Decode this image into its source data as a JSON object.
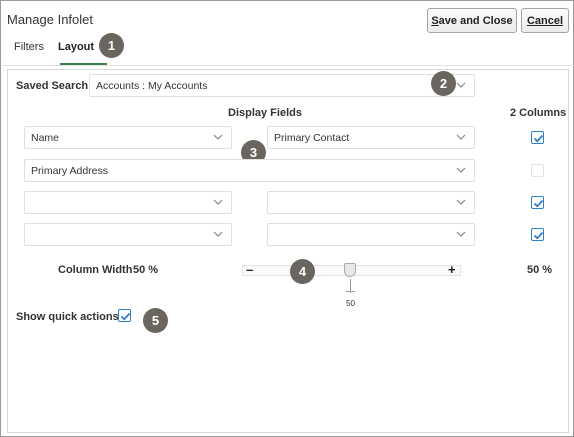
{
  "dialog": {
    "title": "Manage Infolet",
    "save_close_first": "S",
    "save_close_rest": "ave and Close",
    "cancel_first": "C",
    "cancel_rest": "ancel"
  },
  "tabs": [
    {
      "label": "Filters",
      "selected": false
    },
    {
      "label": "Layout",
      "selected": true
    }
  ],
  "saved_search": {
    "label": "Saved Search",
    "value": "Accounts : My Accounts"
  },
  "headers": {
    "display_fields": "Display Fields",
    "two_columns": "2 Columns"
  },
  "rows": [
    {
      "left": "Name",
      "right": "Primary Contact",
      "two_columns": true
    },
    {
      "full": "Primary Address",
      "two_columns": false
    },
    {
      "left": "",
      "right": "",
      "two_columns": true
    },
    {
      "left": "",
      "right": "",
      "two_columns": true
    }
  ],
  "column_width": {
    "label": "Column Width",
    "left_value": "50 %",
    "right_value": "50 %",
    "slider_value": "50",
    "slider_fraction": 0.5,
    "minus": "–",
    "plus": "+"
  },
  "quick_actions": {
    "label": "Show quick actions",
    "checked": true
  },
  "callouts": [
    "1",
    "2",
    "3",
    "4",
    "5"
  ],
  "colors": {
    "accent_tab": "#3f7f4f",
    "checkbox_blue": "#2f7fc8",
    "callout_bg": "#6b6560"
  }
}
